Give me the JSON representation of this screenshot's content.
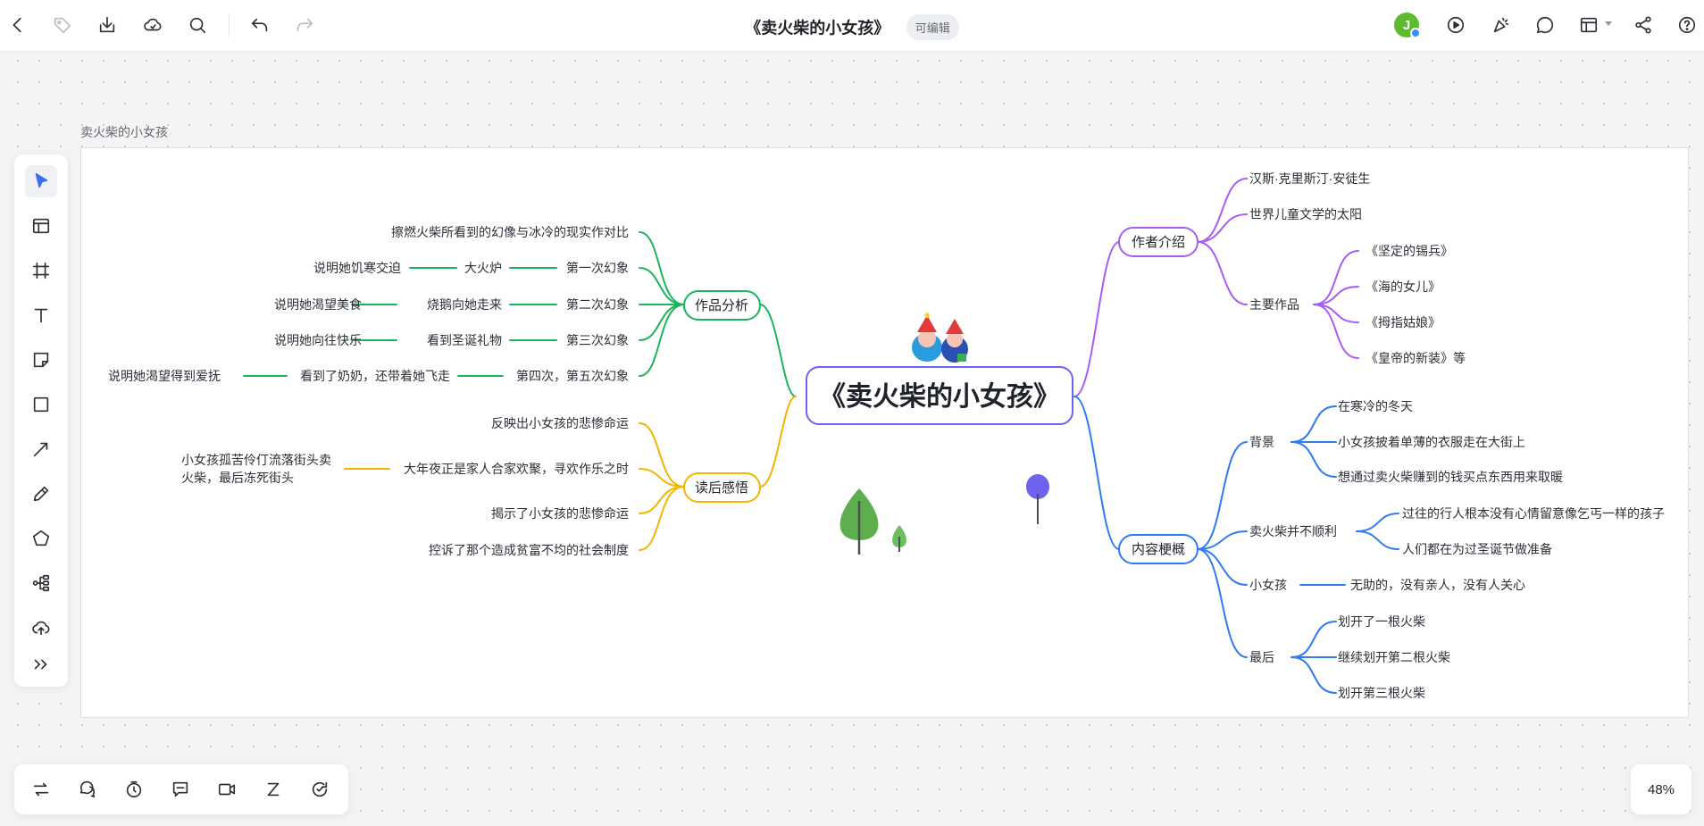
{
  "header": {
    "title": "《卖火柴的小女孩》",
    "edit_badge": "可编辑",
    "avatar_initial": "J",
    "icons": [
      "back-icon",
      "tag-icon",
      "download-icon",
      "cloud-icon",
      "search-icon",
      "undo-icon",
      "redo-icon",
      "present-icon",
      "celebrate-icon",
      "comment-icon",
      "layout-icon",
      "share-icon",
      "help-icon"
    ]
  },
  "frame": {
    "label": "卖火柴的小女孩"
  },
  "mindmap": {
    "root": "《卖火柴的小女孩》",
    "colors": {
      "analysis": "#1db35a",
      "reflection": "#f5b400",
      "author": "#a95cf2",
      "summary": "#2f7bf0",
      "root_border": "#6b64f0"
    },
    "analysis": {
      "label": "作品分析",
      "contrast": "擦燃火柴所看到的幻像与冰冷的现实作对比",
      "rows": [
        {
          "meaning": "说明她饥寒交迫",
          "image": "大火炉",
          "vision": "第一次幻象"
        },
        {
          "meaning": "说明她渴望美食",
          "image": "烧鹅向她走来",
          "vision": "第二次幻象"
        },
        {
          "meaning": "说明她向往快乐",
          "image": "看到圣诞礼物",
          "vision": "第三次幻象"
        },
        {
          "meaning": "说明她渴望得到爱抚",
          "image": "看到了奶奶，还带着她飞走",
          "vision": "第四次，第五次幻象"
        }
      ]
    },
    "reflection": {
      "label": "读后感悟",
      "items": [
        "反映出小女孩的悲惨命运",
        "大年夜正是家人合家欢聚，寻欢作乐之时",
        "揭示了小女孩的悲惨命运",
        "控诉了那个造成贫富不均的社会制度"
      ],
      "sub_line1": "小女孩孤苦伶仃流落街头卖",
      "sub_line2": "火柴，最后冻死街头"
    },
    "author": {
      "label": "作者介绍",
      "name": "汉斯·克里斯汀·安徒生",
      "title": "世界儿童文学的太阳",
      "works_label": "主要作品",
      "works": [
        "《坚定的锡兵》",
        "《海的女儿》",
        "《拇指姑娘》",
        "《皇帝的新装》等"
      ]
    },
    "summary": {
      "label": "内容梗概",
      "background": {
        "label": "背景",
        "items": [
          "在寒冷的冬天",
          "小女孩披着单薄的衣服走在大街上",
          "想通过卖火柴赚到的钱买点东西用来取暖"
        ]
      },
      "selling": {
        "label": "卖火柴并不顺利",
        "items": [
          "过往的行人根本没有心情留意像乞丐一样的孩子",
          "人们都在为过圣诞节做准备"
        ]
      },
      "girl": {
        "label": "小女孩",
        "item": "无助的，没有亲人，没有人关心"
      },
      "end": {
        "label": "最后",
        "items": [
          "划开了一根火柴",
          "继续划开第二根火柴",
          "划开第三根火柴"
        ]
      }
    }
  },
  "left_toolbar": [
    "select-tool",
    "template-tool",
    "frame-tool",
    "text-tool",
    "sticky-note-tool",
    "rectangle-tool",
    "line-tool",
    "pen-tool",
    "shape-tool",
    "mindmap-tool",
    "upload-tool",
    "more-tool"
  ],
  "bottom_toolbar": [
    "swap-icon",
    "chat-bubbles-icon",
    "timer-icon",
    "comment-box-icon",
    "video-icon",
    "sleep-icon",
    "sync-icon"
  ],
  "zoom": {
    "level": "48%"
  }
}
